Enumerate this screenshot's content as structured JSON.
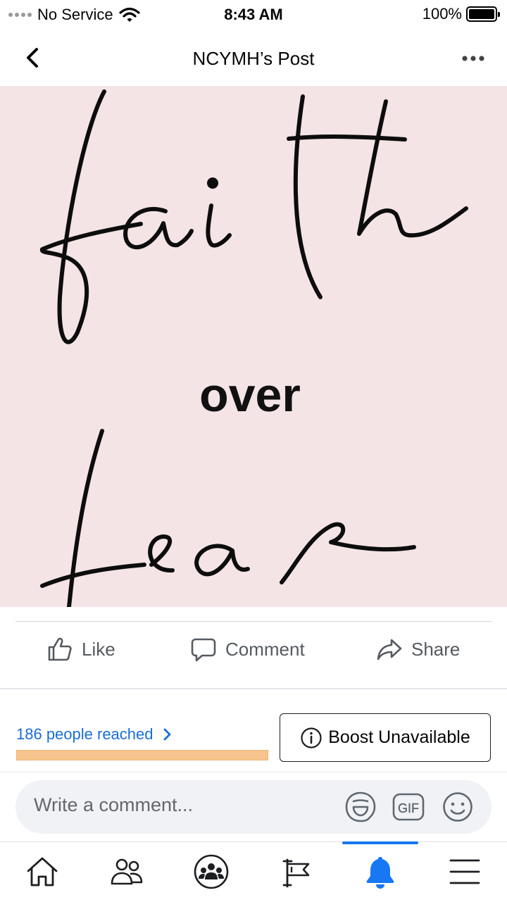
{
  "status_bar": {
    "carrier": "No Service",
    "time": "8:43 AM",
    "battery": "100%"
  },
  "header": {
    "title": "NCYMH’s Post"
  },
  "post": {
    "image_words": [
      "faith",
      "over",
      "fear"
    ]
  },
  "actions": {
    "like_label": "Like",
    "comment_label": "Comment",
    "share_label": "Share"
  },
  "insights": {
    "reach_label": "186 people reached",
    "boost_label": "Boost Unavailable"
  },
  "composer": {
    "placeholder": "Write a comment...",
    "gif_label": "GIF"
  },
  "tabs": [
    {
      "icon": "home-icon"
    },
    {
      "icon": "friends-icon"
    },
    {
      "icon": "groups-icon"
    },
    {
      "icon": "pages-flag-icon"
    },
    {
      "icon": "notifications-bell-icon",
      "active": true
    },
    {
      "icon": "menu-icon"
    }
  ],
  "colors": {
    "accent": "#1877f2",
    "link": "#1a6ed8",
    "reach_bar": "#f6c48c",
    "image_background": "#f4e4e6"
  }
}
